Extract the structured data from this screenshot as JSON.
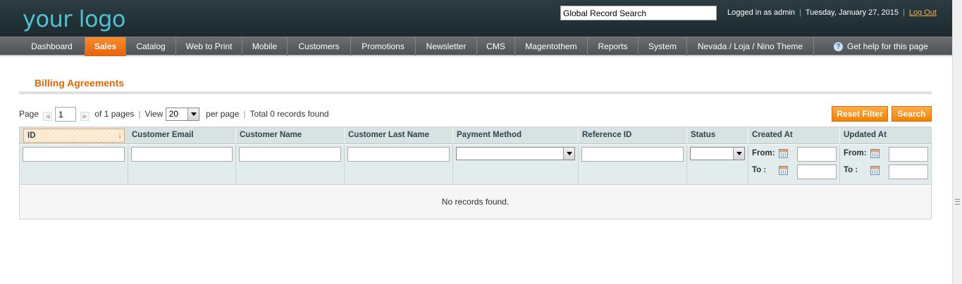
{
  "header": {
    "logo": "your logo",
    "search_value": "Global Record Search",
    "logged_in": "Logged in as admin",
    "date": "Tuesday, January 27, 2015",
    "logout": "Log Out"
  },
  "nav": {
    "items": [
      {
        "label": "Dashboard"
      },
      {
        "label": "Sales",
        "active": true
      },
      {
        "label": "Catalog"
      },
      {
        "label": "Web to Print"
      },
      {
        "label": "Mobile"
      },
      {
        "label": "Customers"
      },
      {
        "label": "Promotions"
      },
      {
        "label": "Newsletter"
      },
      {
        "label": "CMS"
      },
      {
        "label": "Magentothem"
      },
      {
        "label": "Reports"
      },
      {
        "label": "System"
      },
      {
        "label": "Nevada / Loja / Nino Theme"
      }
    ],
    "help": "Get help for this page"
  },
  "page": {
    "title": "Billing Agreements"
  },
  "pager": {
    "page_label": "Page",
    "page_value": "1",
    "of_pages": "of 1 pages",
    "view_label": "View",
    "view_value": "20",
    "per_page": "per page",
    "total": "Total 0 records found"
  },
  "buttons": {
    "reset": "Reset Filter",
    "search": "Search"
  },
  "grid": {
    "columns": [
      "ID",
      "Customer Email",
      "Customer Name",
      "Customer Last Name",
      "Payment Method",
      "Reference ID",
      "Status",
      "Created At",
      "Updated At"
    ],
    "from_label": "From:",
    "to_label": "To :",
    "empty": "No records found."
  },
  "colors": {
    "accent": "#e26703",
    "header_bg": "#1d2a2f",
    "logo": "#4fc0d0",
    "logout": "#f7b34d"
  }
}
